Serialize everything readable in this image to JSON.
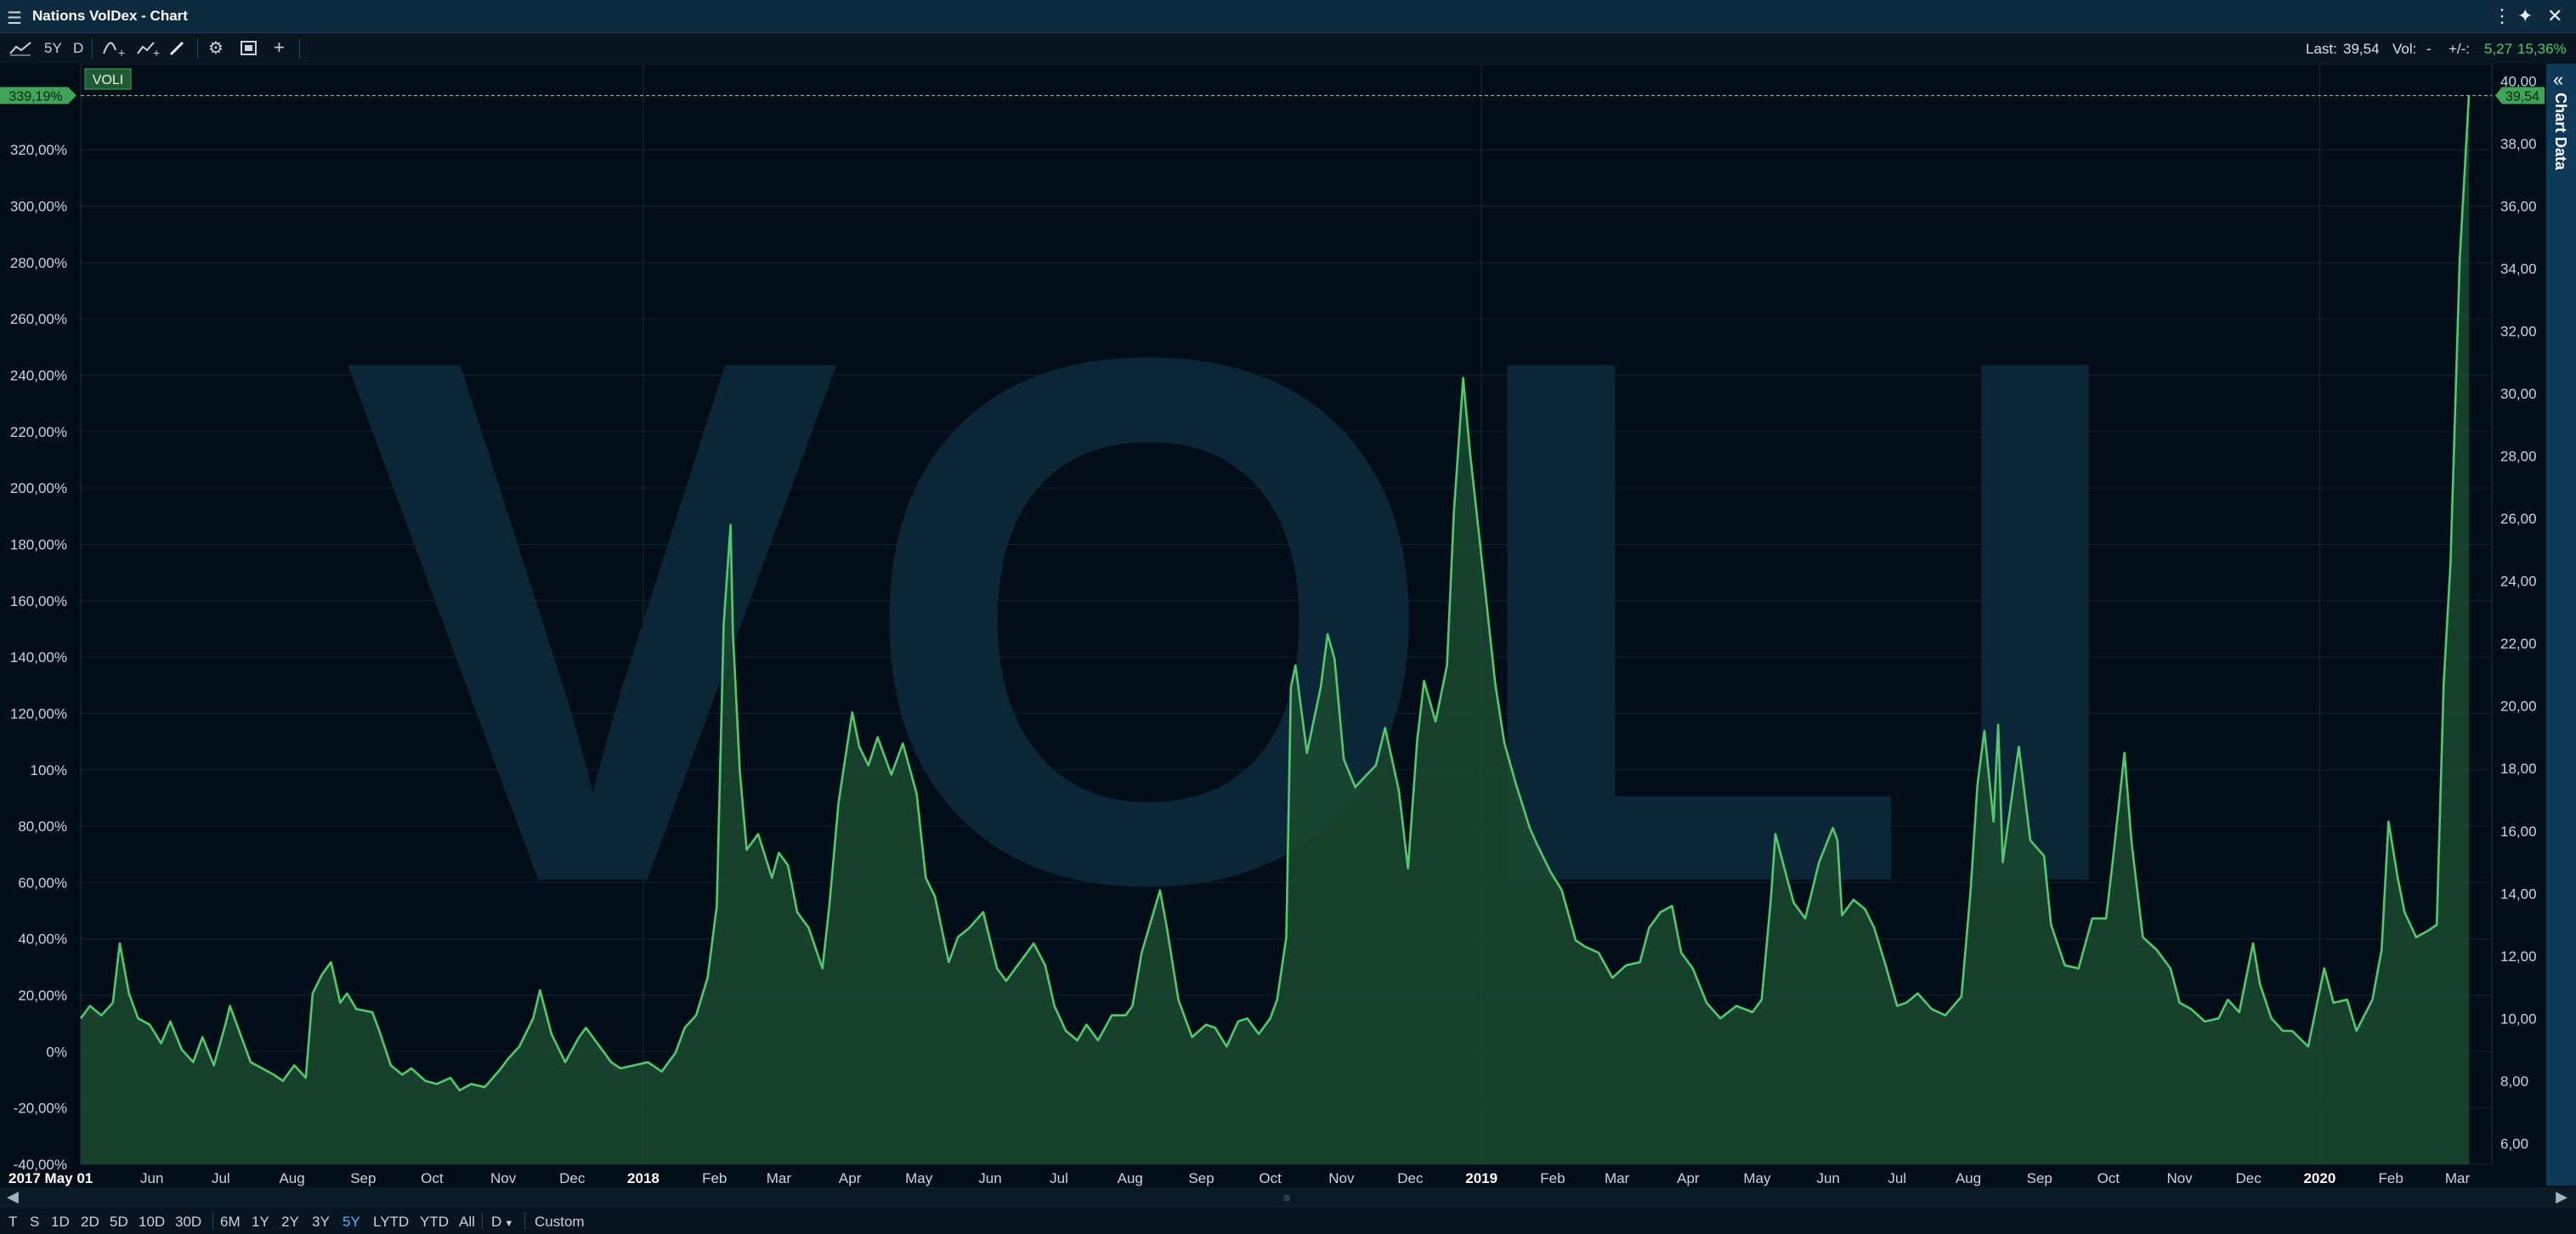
{
  "window": {
    "title": "Nations VolDex - Chart",
    "menu_icon": "hamburger-menu-icon",
    "controls": [
      "more-icon",
      "unlink-icon",
      "close-icon"
    ]
  },
  "toolbar": {
    "period": "5Y",
    "interval": "D",
    "last_label": "Last:",
    "last_value": "39,54",
    "vol_label": "Vol:",
    "vol_value": "-",
    "change_label": "+/-:",
    "change_abs": "5,27",
    "change_pct": "15,36%"
  },
  "sidebar": {
    "label": "Chart Data"
  },
  "range_bar": {
    "buttons": [
      "T",
      "S",
      "1D",
      "2D",
      "5D",
      "10D",
      "30D",
      "6M",
      "1Y",
      "2Y",
      "3Y",
      "5Y",
      "LYTD",
      "YTD",
      "All"
    ],
    "active": "5Y",
    "interval": "D",
    "custom": "Custom"
  },
  "colors": {
    "line": "#52c96c",
    "fill": "#1c4a31",
    "badge": "#3fa458",
    "background": "#020e17",
    "grid": "#0c2633"
  },
  "chart_data": {
    "type": "area",
    "series_name": "VOLI",
    "watermark": "VOLI",
    "xlabel": "",
    "ylabel": "",
    "x_range": [
      "2017-05-01",
      "2020-03-06"
    ],
    "left_axis": {
      "unit": "%",
      "range": [
        -40,
        346
      ],
      "ticks": [
        "-40,00%",
        "-20,00%",
        "0%",
        "20,00%",
        "40,00%",
        "60,00%",
        "80,00%",
        "100%",
        "120,00%",
        "140,00%",
        "160,00%",
        "180,00%",
        "200,00%",
        "220,00%",
        "240,00%",
        "260,00%",
        "280,00%",
        "300,00%",
        "320,00%"
      ],
      "current_badge": "339,19%"
    },
    "right_axis": {
      "range": [
        5.33,
        40.15
      ],
      "ticks": [
        "6,00",
        "8,00",
        "10,00",
        "12,00",
        "14,00",
        "16,00",
        "18,00",
        "20,00",
        "22,00",
        "24,00",
        "26,00",
        "28,00",
        "30,00",
        "32,00",
        "34,00",
        "36,00",
        "38,00",
        "40,00"
      ],
      "current_badge": "39,54"
    },
    "x_tick_labels": [
      "2017 May 01",
      "Jun",
      "Jul",
      "Aug",
      "Sep",
      "Oct",
      "Nov",
      "Dec",
      "2018",
      "Feb",
      "Mar",
      "Apr",
      "May",
      "Jun",
      "Jul",
      "Aug",
      "Sep",
      "Oct",
      "Nov",
      "Dec",
      "2019",
      "Feb",
      "Mar",
      "Apr",
      "May",
      "Jun",
      "Jul",
      "Aug",
      "Sep",
      "Oct",
      "Nov",
      "Dec",
      "2020",
      "Feb",
      "Mar"
    ],
    "x_tick_dates": [
      "2017-05-01",
      "2017-06-01",
      "2017-07-01",
      "2017-08-01",
      "2017-09-01",
      "2017-10-01",
      "2017-11-01",
      "2017-12-01",
      "2018-01-01",
      "2018-02-01",
      "2018-03-01",
      "2018-04-01",
      "2018-05-01",
      "2018-06-01",
      "2018-07-01",
      "2018-08-01",
      "2018-09-01",
      "2018-10-01",
      "2018-11-01",
      "2018-12-01",
      "2019-01-01",
      "2019-02-01",
      "2019-03-01",
      "2019-04-01",
      "2019-05-01",
      "2019-06-01",
      "2019-07-01",
      "2019-08-01",
      "2019-09-01",
      "2019-10-01",
      "2019-11-01",
      "2019-12-01",
      "2020-01-01",
      "2020-02-01",
      "2020-03-01"
    ],
    "x_bold_labels": [
      "2017 May 01",
      "2018",
      "2019",
      "2020"
    ],
    "grid": true,
    "points": [
      [
        "2017-05-01",
        10.0
      ],
      [
        "2017-05-05",
        10.4
      ],
      [
        "2017-05-10",
        10.1
      ],
      [
        "2017-05-15",
        10.5
      ],
      [
        "2017-05-18",
        12.4
      ],
      [
        "2017-05-22",
        10.8
      ],
      [
        "2017-05-26",
        10.0
      ],
      [
        "2017-05-31",
        9.8
      ],
      [
        "2017-06-05",
        9.2
      ],
      [
        "2017-06-09",
        9.9
      ],
      [
        "2017-06-14",
        9.0
      ],
      [
        "2017-06-19",
        8.6
      ],
      [
        "2017-06-23",
        9.4
      ],
      [
        "2017-06-28",
        8.5
      ],
      [
        "2017-07-03",
        9.8
      ],
      [
        "2017-07-05",
        10.4
      ],
      [
        "2017-07-10",
        9.4
      ],
      [
        "2017-07-14",
        8.6
      ],
      [
        "2017-07-19",
        8.4
      ],
      [
        "2017-07-24",
        8.2
      ],
      [
        "2017-07-28",
        8.0
      ],
      [
        "2017-08-02",
        8.5
      ],
      [
        "2017-08-07",
        8.1
      ],
      [
        "2017-08-10",
        10.8
      ],
      [
        "2017-08-14",
        11.4
      ],
      [
        "2017-08-18",
        11.8
      ],
      [
        "2017-08-22",
        10.5
      ],
      [
        "2017-08-25",
        10.8
      ],
      [
        "2017-08-29",
        10.3
      ],
      [
        "2017-09-05",
        10.2
      ],
      [
        "2017-09-08",
        9.6
      ],
      [
        "2017-09-13",
        8.5
      ],
      [
        "2017-09-18",
        8.2
      ],
      [
        "2017-09-22",
        8.4
      ],
      [
        "2017-09-28",
        8.0
      ],
      [
        "2017-10-03",
        7.9
      ],
      [
        "2017-10-09",
        8.1
      ],
      [
        "2017-10-13",
        7.7
      ],
      [
        "2017-10-18",
        7.9
      ],
      [
        "2017-10-24",
        7.8
      ],
      [
        "2017-10-31",
        8.4
      ],
      [
        "2017-11-03",
        8.7
      ],
      [
        "2017-11-08",
        9.1
      ],
      [
        "2017-11-14",
        10.0
      ],
      [
        "2017-11-17",
        10.9
      ],
      [
        "2017-11-22",
        9.5
      ],
      [
        "2017-11-28",
        8.6
      ],
      [
        "2017-12-04",
        9.4
      ],
      [
        "2017-12-07",
        9.7
      ],
      [
        "2017-12-12",
        9.2
      ],
      [
        "2017-12-18",
        8.6
      ],
      [
        "2017-12-22",
        8.4
      ],
      [
        "2017-12-28",
        8.5
      ],
      [
        "2018-01-03",
        8.6
      ],
      [
        "2018-01-09",
        8.3
      ],
      [
        "2018-01-15",
        8.9
      ],
      [
        "2018-01-19",
        9.7
      ],
      [
        "2018-01-24",
        10.1
      ],
      [
        "2018-01-29",
        11.3
      ],
      [
        "2018-02-02",
        13.6
      ],
      [
        "2018-02-05",
        22.6
      ],
      [
        "2018-02-08",
        25.8
      ],
      [
        "2018-02-09",
        22.4
      ],
      [
        "2018-02-12",
        17.9
      ],
      [
        "2018-02-15",
        15.4
      ],
      [
        "2018-02-20",
        15.9
      ],
      [
        "2018-02-26",
        14.5
      ],
      [
        "2018-03-01",
        15.3
      ],
      [
        "2018-03-05",
        14.9
      ],
      [
        "2018-03-09",
        13.4
      ],
      [
        "2018-03-14",
        12.9
      ],
      [
        "2018-03-20",
        11.6
      ],
      [
        "2018-03-23",
        13.6
      ],
      [
        "2018-03-27",
        16.9
      ],
      [
        "2018-04-02",
        19.8
      ],
      [
        "2018-04-05",
        18.7
      ],
      [
        "2018-04-09",
        18.1
      ],
      [
        "2018-04-13",
        19.0
      ],
      [
        "2018-04-19",
        17.8
      ],
      [
        "2018-04-24",
        18.8
      ],
      [
        "2018-04-30",
        17.2
      ],
      [
        "2018-05-04",
        14.5
      ],
      [
        "2018-05-08",
        13.9
      ],
      [
        "2018-05-14",
        11.8
      ],
      [
        "2018-05-18",
        12.6
      ],
      [
        "2018-05-23",
        12.9
      ],
      [
        "2018-05-29",
        13.4
      ],
      [
        "2018-06-04",
        11.6
      ],
      [
        "2018-06-08",
        11.2
      ],
      [
        "2018-06-14",
        11.8
      ],
      [
        "2018-06-20",
        12.4
      ],
      [
        "2018-06-25",
        11.7
      ],
      [
        "2018-06-29",
        10.4
      ],
      [
        "2018-07-04",
        9.6
      ],
      [
        "2018-07-09",
        9.3
      ],
      [
        "2018-07-13",
        9.8
      ],
      [
        "2018-07-18",
        9.3
      ],
      [
        "2018-07-24",
        10.1
      ],
      [
        "2018-07-30",
        10.1
      ],
      [
        "2018-08-02",
        10.4
      ],
      [
        "2018-08-06",
        12.1
      ],
      [
        "2018-08-10",
        13.1
      ],
      [
        "2018-08-14",
        14.1
      ],
      [
        "2018-08-17",
        12.9
      ],
      [
        "2018-08-22",
        10.6
      ],
      [
        "2018-08-28",
        9.4
      ],
      [
        "2018-09-03",
        9.8
      ],
      [
        "2018-09-07",
        9.7
      ],
      [
        "2018-09-12",
        9.1
      ],
      [
        "2018-09-17",
        9.9
      ],
      [
        "2018-09-21",
        10.0
      ],
      [
        "2018-09-26",
        9.5
      ],
      [
        "2018-10-01",
        10.0
      ],
      [
        "2018-10-04",
        10.6
      ],
      [
        "2018-10-08",
        12.6
      ],
      [
        "2018-10-10",
        20.6
      ],
      [
        "2018-10-12",
        21.3
      ],
      [
        "2018-10-17",
        18.5
      ],
      [
        "2018-10-23",
        20.6
      ],
      [
        "2018-10-26",
        22.3
      ],
      [
        "2018-10-29",
        21.5
      ],
      [
        "2018-11-02",
        18.3
      ],
      [
        "2018-11-07",
        17.4
      ],
      [
        "2018-11-12",
        17.8
      ],
      [
        "2018-11-16",
        18.1
      ],
      [
        "2018-11-20",
        19.3
      ],
      [
        "2018-11-26",
        17.3
      ],
      [
        "2018-11-30",
        14.8
      ],
      [
        "2018-12-04",
        18.9
      ],
      [
        "2018-12-07",
        20.8
      ],
      [
        "2018-12-12",
        19.5
      ],
      [
        "2018-12-17",
        21.3
      ],
      [
        "2018-12-20",
        26.2
      ],
      [
        "2018-12-24",
        30.5
      ],
      [
        "2018-12-27",
        28.1
      ],
      [
        "2019-01-02",
        24.1
      ],
      [
        "2019-01-07",
        20.7
      ],
      [
        "2019-01-11",
        18.8
      ],
      [
        "2019-01-16",
        17.5
      ],
      [
        "2019-01-22",
        16.1
      ],
      [
        "2019-01-25",
        15.6
      ],
      [
        "2019-01-31",
        14.7
      ],
      [
        "2019-02-05",
        14.1
      ],
      [
        "2019-02-11",
        12.5
      ],
      [
        "2019-02-15",
        12.3
      ],
      [
        "2019-02-21",
        12.1
      ],
      [
        "2019-02-27",
        11.3
      ],
      [
        "2019-03-05",
        11.7
      ],
      [
        "2019-03-11",
        11.8
      ],
      [
        "2019-03-15",
        12.9
      ],
      [
        "2019-03-20",
        13.4
      ],
      [
        "2019-03-25",
        13.6
      ],
      [
        "2019-03-29",
        12.1
      ],
      [
        "2019-04-03",
        11.6
      ],
      [
        "2019-04-09",
        10.5
      ],
      [
        "2019-04-15",
        10.0
      ],
      [
        "2019-04-22",
        10.4
      ],
      [
        "2019-04-29",
        10.2
      ],
      [
        "2019-05-03",
        10.6
      ],
      [
        "2019-05-07",
        13.8
      ],
      [
        "2019-05-09",
        15.9
      ],
      [
        "2019-05-14",
        14.5
      ],
      [
        "2019-05-17",
        13.7
      ],
      [
        "2019-05-22",
        13.2
      ],
      [
        "2019-05-28",
        15.0
      ],
      [
        "2019-06-03",
        16.1
      ],
      [
        "2019-06-05",
        15.7
      ],
      [
        "2019-06-07",
        13.3
      ],
      [
        "2019-06-12",
        13.8
      ],
      [
        "2019-06-17",
        13.5
      ],
      [
        "2019-06-21",
        12.9
      ],
      [
        "2019-06-26",
        11.7
      ],
      [
        "2019-07-01",
        10.4
      ],
      [
        "2019-07-05",
        10.5
      ],
      [
        "2019-07-10",
        10.8
      ],
      [
        "2019-07-16",
        10.3
      ],
      [
        "2019-07-22",
        10.1
      ],
      [
        "2019-07-29",
        10.7
      ],
      [
        "2019-08-02",
        14.1
      ],
      [
        "2019-08-05",
        17.5
      ],
      [
        "2019-08-08",
        19.2
      ],
      [
        "2019-08-12",
        16.3
      ],
      [
        "2019-08-14",
        19.4
      ],
      [
        "2019-08-16",
        15.0
      ],
      [
        "2019-08-23",
        18.7
      ],
      [
        "2019-08-28",
        15.7
      ],
      [
        "2019-09-03",
        15.2
      ],
      [
        "2019-09-06",
        13.0
      ],
      [
        "2019-09-12",
        11.7
      ],
      [
        "2019-09-18",
        11.6
      ],
      [
        "2019-09-24",
        13.2
      ],
      [
        "2019-09-30",
        13.2
      ],
      [
        "2019-10-03",
        15.1
      ],
      [
        "2019-10-08",
        18.5
      ],
      [
        "2019-10-11",
        15.7
      ],
      [
        "2019-10-16",
        12.6
      ],
      [
        "2019-10-22",
        12.2
      ],
      [
        "2019-10-28",
        11.6
      ],
      [
        "2019-11-01",
        10.5
      ],
      [
        "2019-11-06",
        10.3
      ],
      [
        "2019-11-12",
        9.9
      ],
      [
        "2019-11-18",
        10.0
      ],
      [
        "2019-11-22",
        10.6
      ],
      [
        "2019-11-27",
        10.2
      ],
      [
        "2019-12-03",
        12.4
      ],
      [
        "2019-12-06",
        11.1
      ],
      [
        "2019-12-11",
        10.0
      ],
      [
        "2019-12-16",
        9.6
      ],
      [
        "2019-12-20",
        9.6
      ],
      [
        "2019-12-27",
        9.1
      ],
      [
        "2020-01-03",
        11.6
      ],
      [
        "2020-01-07",
        10.5
      ],
      [
        "2020-01-13",
        10.6
      ],
      [
        "2020-01-17",
        9.6
      ],
      [
        "2020-01-24",
        10.6
      ],
      [
        "2020-01-28",
        12.2
      ],
      [
        "2020-01-31",
        16.3
      ],
      [
        "2020-02-04",
        14.5
      ],
      [
        "2020-02-07",
        13.4
      ],
      [
        "2020-02-12",
        12.6
      ],
      [
        "2020-02-17",
        12.8
      ],
      [
        "2020-02-21",
        13.0
      ],
      [
        "2020-02-24",
        20.7
      ],
      [
        "2020-02-27",
        24.6
      ],
      [
        "2020-03-02",
        34.3
      ],
      [
        "2020-03-06",
        39.54
      ]
    ]
  }
}
